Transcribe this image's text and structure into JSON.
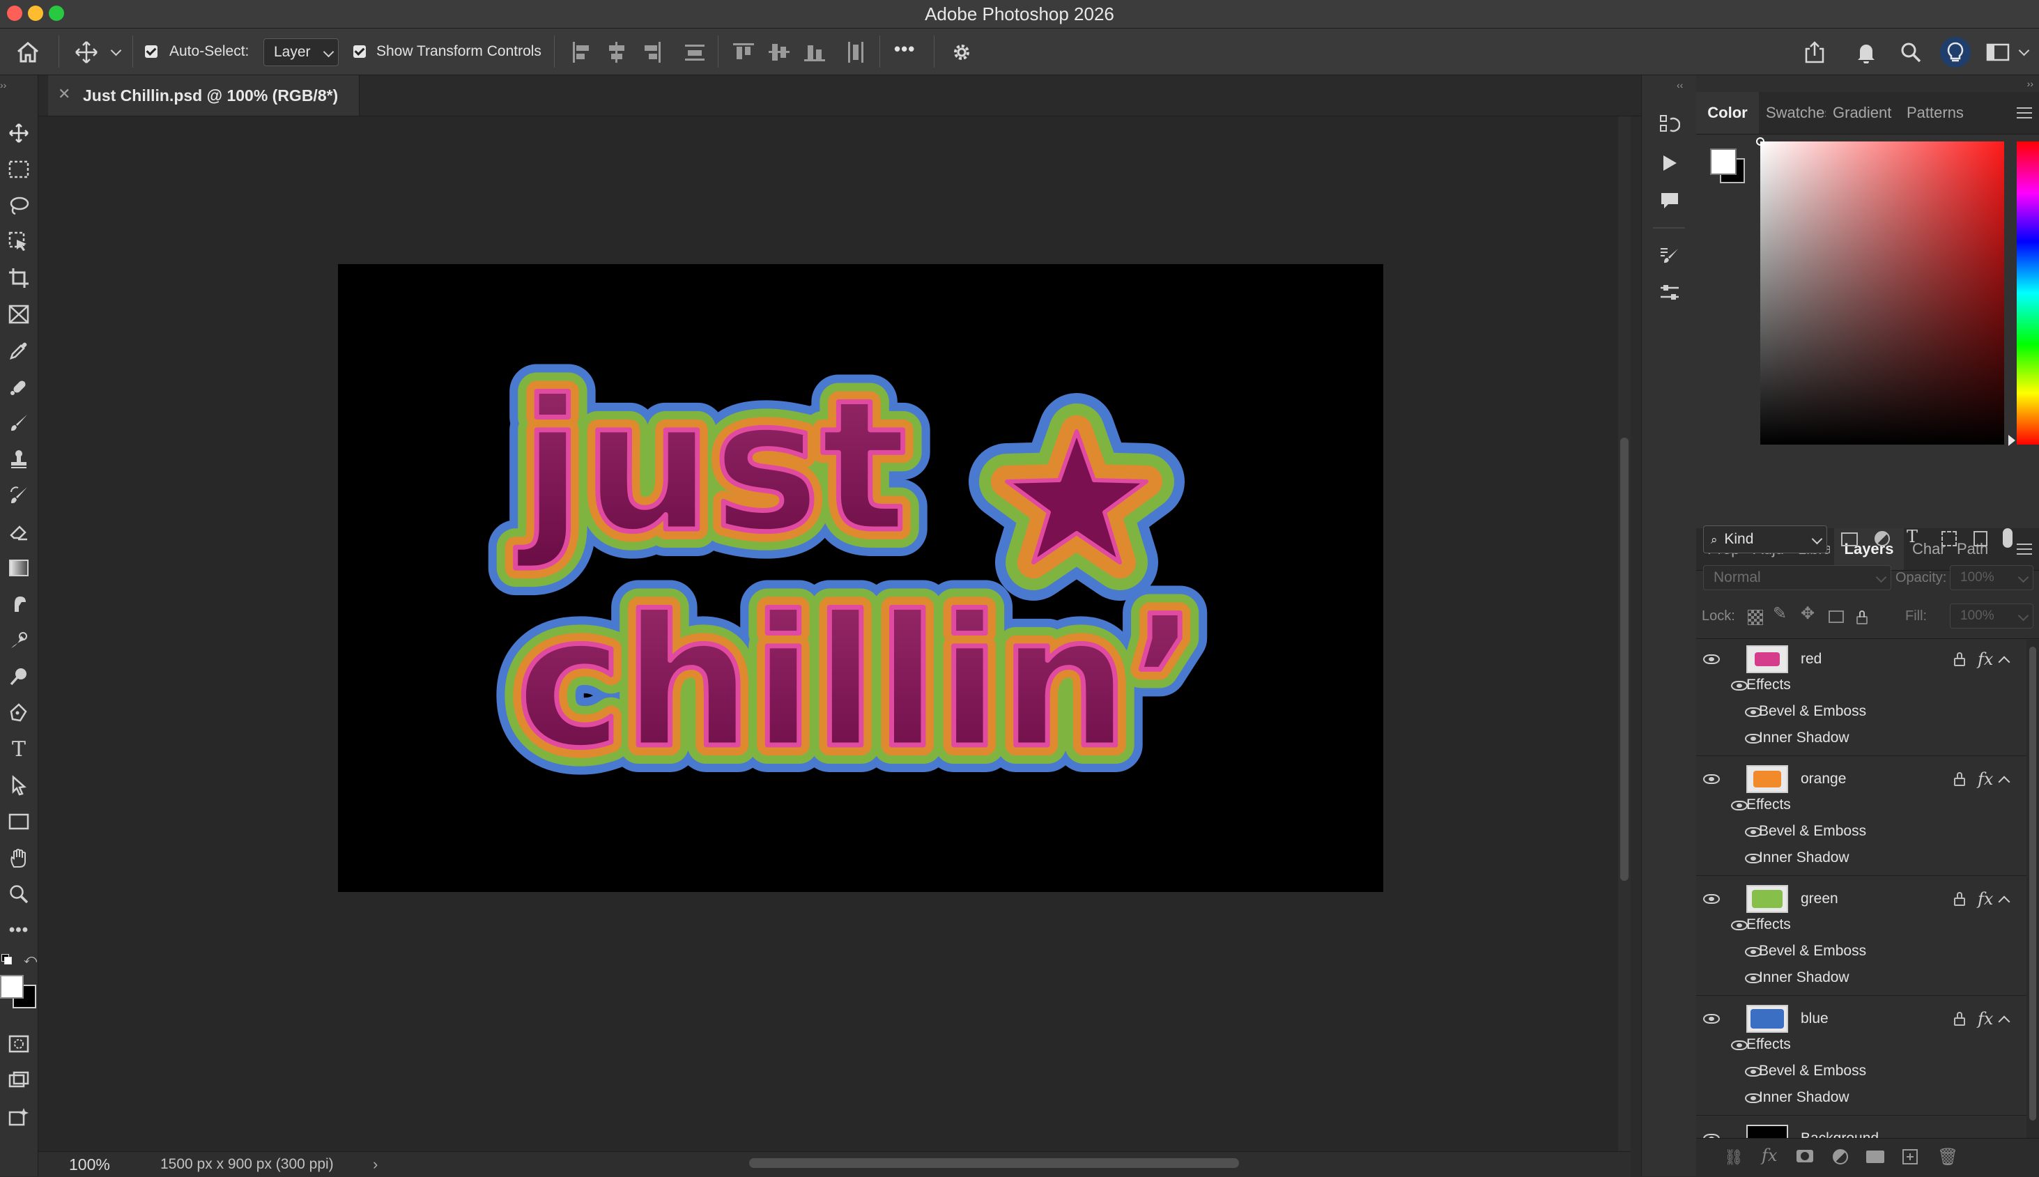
{
  "app": {
    "window_title": "Adobe Photoshop 2026"
  },
  "options_bar": {
    "auto_select_label": "Auto-Select:",
    "auto_select_checked": true,
    "auto_select_target": "Layer",
    "show_transform_label": "Show Transform Controls",
    "show_transform_checked": true,
    "more_label": "•••"
  },
  "document": {
    "tab_title": "Just Chillin.psd @ 100% (RGB/8*)",
    "artwork_text_line1": "just",
    "artwork_text_line2": "chillin’"
  },
  "status_bar": {
    "zoom": "100%",
    "dimensions": "1500 px x 900 px (300 ppi)"
  },
  "color_panel": {
    "tabs": [
      "Color",
      "Swatches",
      "Gradient",
      "Patterns"
    ],
    "active_tab": "Color",
    "foreground_color": "#ffffff",
    "background_color": "#000000"
  },
  "layers_panel": {
    "tabs": [
      "Prop",
      "Adju",
      "Libra",
      "Layers",
      "Char",
      "Path"
    ],
    "active_tab": "Layers",
    "filter_kind": "Kind",
    "blend_mode": "Normal",
    "opacity_label": "Opacity:",
    "opacity_value": "100%",
    "lock_label": "Lock:",
    "fill_label": "Fill:",
    "fill_value": "100%",
    "layers": [
      {
        "name": "red",
        "effects_label": "Effects",
        "effects": [
          "Bevel & Emboss",
          "Inner Shadow"
        ],
        "thumb_color": "#d63c8c"
      },
      {
        "name": "orange",
        "effects_label": "Effects",
        "effects": [
          "Bevel & Emboss",
          "Inner Shadow"
        ],
        "thumb_color": "#f08a2a"
      },
      {
        "name": "green",
        "effects_label": "Effects",
        "effects": [
          "Bevel & Emboss",
          "Inner Shadow"
        ],
        "thumb_color": "#86c04a"
      },
      {
        "name": "blue",
        "effects_label": "Effects",
        "effects": [
          "Bevel & Emboss",
          "Inner Shadow"
        ],
        "thumb_color": "#3a6fc4"
      },
      {
        "name": "Background",
        "thumb_color": "#000000"
      }
    ]
  }
}
